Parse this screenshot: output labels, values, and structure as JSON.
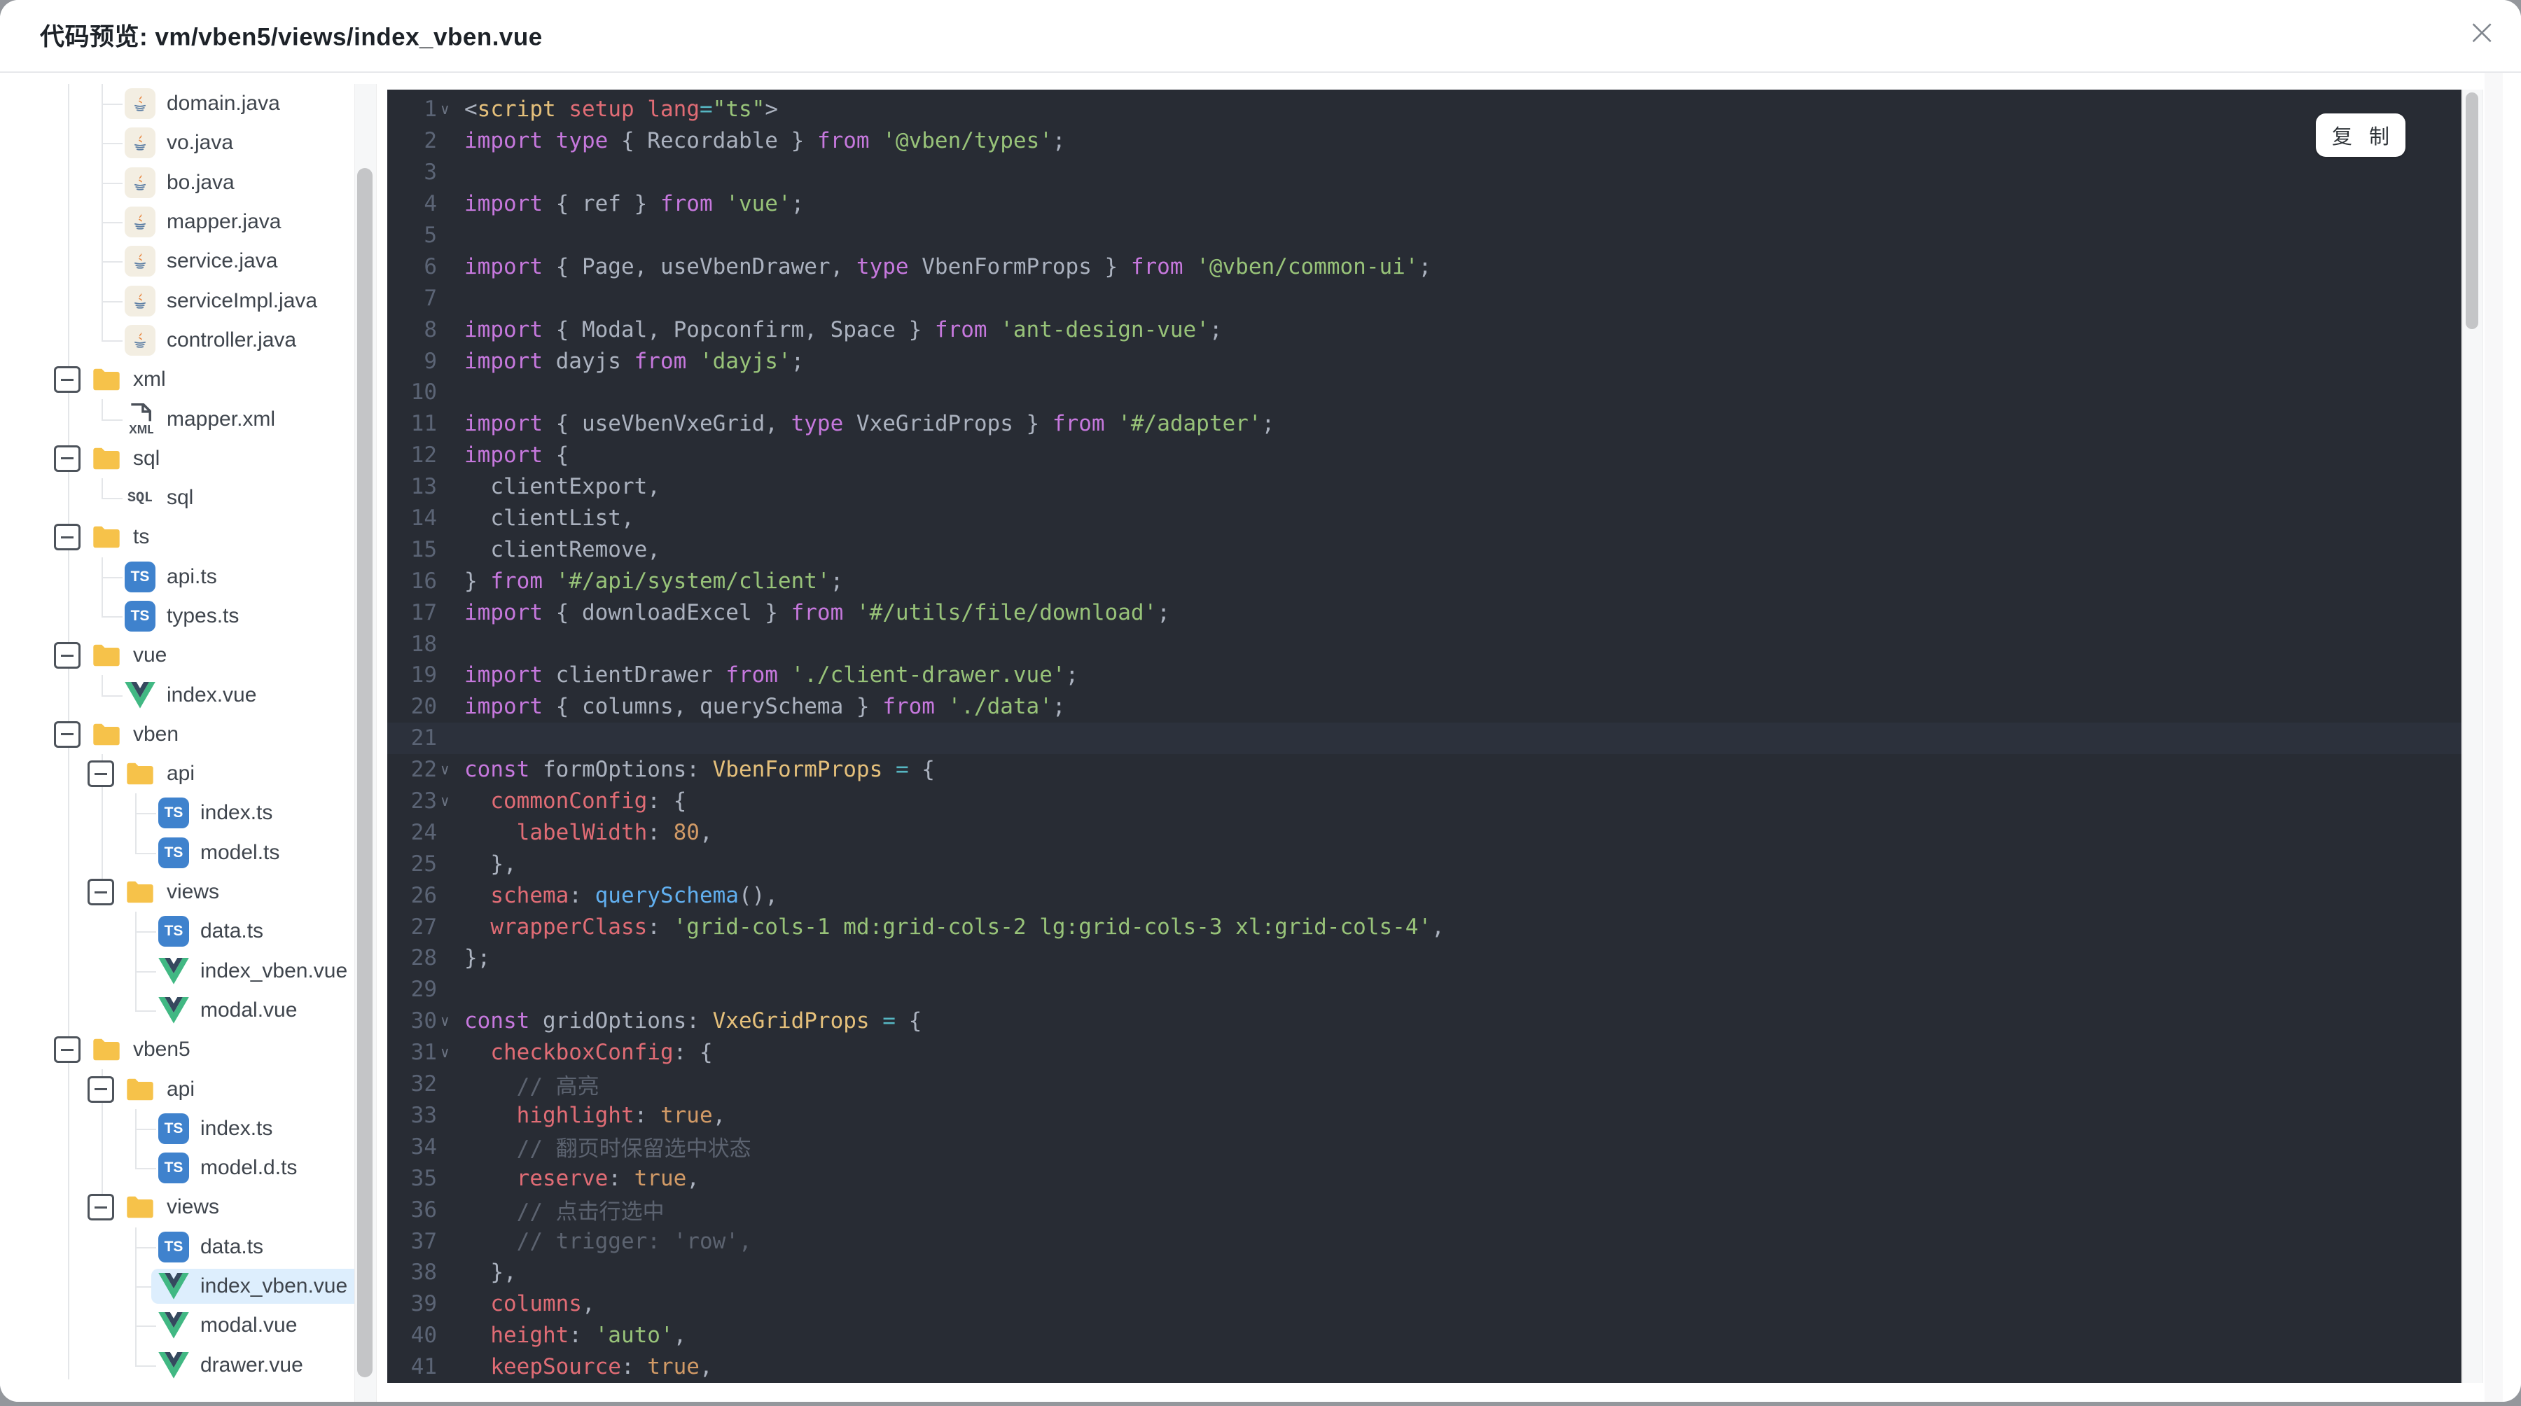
{
  "window": {
    "title": "代码预览: vm/vben5/views/index_vben.vue",
    "close_label": "×"
  },
  "toolbar": {
    "copy_label": "复 制"
  },
  "colors": {
    "editor_bg": "#282c34",
    "current_line": "#2c313c",
    "selected_item_bg": "#ddeefd",
    "folder": "#f6c24a",
    "ts_badge": "#3f82cd",
    "vue_green": "#41b883",
    "vue_navy": "#35495e",
    "keyword": "#c678dd",
    "string": "#98c379",
    "property": "#e06c75",
    "number": "#d19a66"
  },
  "sidebar": {
    "items": [
      {
        "label": "domain.java",
        "icon": "java",
        "stub": 145
      },
      {
        "label": "vo.java",
        "icon": "java",
        "stub": 145
      },
      {
        "label": "bo.java",
        "icon": "java",
        "stub": 145
      },
      {
        "label": "mapper.java",
        "icon": "java",
        "stub": 145
      },
      {
        "label": "service.java",
        "icon": "java",
        "stub": 145
      },
      {
        "label": "serviceImpl.java",
        "icon": "java",
        "stub": 145
      },
      {
        "label": "controller.java",
        "icon": "java",
        "stub": 145,
        "end": true
      },
      {
        "label": "xml",
        "icon": "folder",
        "exp": 77
      },
      {
        "label": "mapper.xml",
        "icon": "xml",
        "stub": 145,
        "end": true
      },
      {
        "label": "sql",
        "icon": "folder",
        "exp": 77
      },
      {
        "label": "sql",
        "icon": "sql",
        "stub": 145,
        "end": true
      },
      {
        "label": "ts",
        "icon": "folder",
        "exp": 77
      },
      {
        "label": "api.ts",
        "icon": "ts",
        "stub": 145
      },
      {
        "label": "types.ts",
        "icon": "ts",
        "stub": 145,
        "end": true
      },
      {
        "label": "vue",
        "icon": "folder",
        "exp": 77
      },
      {
        "label": "index.vue",
        "icon": "vue",
        "stub": 145,
        "end": true
      },
      {
        "label": "vben",
        "icon": "folder",
        "exp": 77
      },
      {
        "label": "api",
        "icon": "folder",
        "exp": 125,
        "guides": [
          145
        ]
      },
      {
        "label": "index.ts",
        "icon": "ts",
        "stub": 193,
        "guides": [
          145
        ]
      },
      {
        "label": "model.ts",
        "icon": "ts",
        "stub": 193,
        "guides": [
          145
        ],
        "end": true
      },
      {
        "label": "views",
        "icon": "folder",
        "exp": 125,
        "guides": [
          145
        ],
        "gend": true
      },
      {
        "label": "data.ts",
        "icon": "ts",
        "stub": 193
      },
      {
        "label": "index_vben.vue",
        "icon": "vue",
        "stub": 193
      },
      {
        "label": "modal.vue",
        "icon": "vue",
        "stub": 193,
        "end": true
      },
      {
        "label": "vben5",
        "icon": "folder",
        "exp": 77
      },
      {
        "label": "api",
        "icon": "folder",
        "exp": 125,
        "guides": [
          145
        ]
      },
      {
        "label": "index.ts",
        "icon": "ts",
        "stub": 193,
        "guides": [
          145
        ]
      },
      {
        "label": "model.d.ts",
        "icon": "ts",
        "stub": 193,
        "guides": [
          145
        ],
        "end": true
      },
      {
        "label": "views",
        "icon": "folder",
        "exp": 125,
        "guides": [
          145
        ],
        "gend": true
      },
      {
        "label": "data.ts",
        "icon": "ts",
        "stub": 193
      },
      {
        "label": "index_vben.vue",
        "icon": "vue",
        "stub": 193,
        "selected": true
      },
      {
        "label": "modal.vue",
        "icon": "vue",
        "stub": 193
      },
      {
        "label": "drawer.vue",
        "icon": "vue",
        "stub": 193,
        "end": true
      }
    ]
  },
  "code": {
    "lines": [
      {
        "n": 1,
        "f": 1,
        "t": [
          [
            "txt",
            "<"
          ],
          [
            "tag",
            "script"
          ],
          [
            "txt",
            " "
          ],
          [
            "prop",
            "setup"
          ],
          [
            "txt",
            " "
          ],
          [
            "prop",
            "lang"
          ],
          [
            "op",
            "="
          ],
          [
            "str",
            "\"ts\""
          ],
          [
            "txt",
            ">"
          ]
        ]
      },
      {
        "n": 2,
        "t": [
          [
            "kw",
            "import"
          ],
          [
            "txt",
            " "
          ],
          [
            "kw",
            "type"
          ],
          [
            "txt",
            " { Recordable } "
          ],
          [
            "kw",
            "from"
          ],
          [
            "txt",
            " "
          ],
          [
            "str",
            "'@vben/types'"
          ],
          [
            "txt",
            ";"
          ]
        ]
      },
      {
        "n": 3,
        "t": []
      },
      {
        "n": 4,
        "t": [
          [
            "kw",
            "import"
          ],
          [
            "txt",
            " { ref } "
          ],
          [
            "kw",
            "from"
          ],
          [
            "txt",
            " "
          ],
          [
            "str",
            "'vue'"
          ],
          [
            "txt",
            ";"
          ]
        ]
      },
      {
        "n": 5,
        "t": []
      },
      {
        "n": 6,
        "t": [
          [
            "kw",
            "import"
          ],
          [
            "txt",
            " { Page, useVbenDrawer, "
          ],
          [
            "kw",
            "type"
          ],
          [
            "txt",
            " VbenFormProps } "
          ],
          [
            "kw",
            "from"
          ],
          [
            "txt",
            " "
          ],
          [
            "str",
            "'@vben/common-ui'"
          ],
          [
            "txt",
            ";"
          ]
        ]
      },
      {
        "n": 7,
        "t": []
      },
      {
        "n": 8,
        "t": [
          [
            "kw",
            "import"
          ],
          [
            "txt",
            " { Modal, Popconfirm, Space } "
          ],
          [
            "kw",
            "from"
          ],
          [
            "txt",
            " "
          ],
          [
            "str",
            "'ant-design-vue'"
          ],
          [
            "txt",
            ";"
          ]
        ]
      },
      {
        "n": 9,
        "t": [
          [
            "kw",
            "import"
          ],
          [
            "txt",
            " dayjs "
          ],
          [
            "kw",
            "from"
          ],
          [
            "txt",
            " "
          ],
          [
            "str",
            "'dayjs'"
          ],
          [
            "txt",
            ";"
          ]
        ]
      },
      {
        "n": 10,
        "t": []
      },
      {
        "n": 11,
        "t": [
          [
            "kw",
            "import"
          ],
          [
            "txt",
            " { useVbenVxeGrid, "
          ],
          [
            "kw",
            "type"
          ],
          [
            "txt",
            " VxeGridProps } "
          ],
          [
            "kw",
            "from"
          ],
          [
            "txt",
            " "
          ],
          [
            "str",
            "'#/adapter'"
          ],
          [
            "txt",
            ";"
          ]
        ]
      },
      {
        "n": 12,
        "t": [
          [
            "kw",
            "import"
          ],
          [
            "txt",
            " {"
          ]
        ]
      },
      {
        "n": 13,
        "t": [
          [
            "txt",
            "  clientExport,"
          ]
        ]
      },
      {
        "n": 14,
        "t": [
          [
            "txt",
            "  clientList,"
          ]
        ]
      },
      {
        "n": 15,
        "t": [
          [
            "txt",
            "  clientRemove,"
          ]
        ]
      },
      {
        "n": 16,
        "t": [
          [
            "txt",
            "} "
          ],
          [
            "kw",
            "from"
          ],
          [
            "txt",
            " "
          ],
          [
            "str",
            "'#/api/system/client'"
          ],
          [
            "txt",
            ";"
          ]
        ]
      },
      {
        "n": 17,
        "t": [
          [
            "kw",
            "import"
          ],
          [
            "txt",
            " { downloadExcel } "
          ],
          [
            "kw",
            "from"
          ],
          [
            "txt",
            " "
          ],
          [
            "str",
            "'#/utils/file/download'"
          ],
          [
            "txt",
            ";"
          ]
        ]
      },
      {
        "n": 18,
        "t": []
      },
      {
        "n": 19,
        "t": [
          [
            "kw",
            "import"
          ],
          [
            "txt",
            " clientDrawer "
          ],
          [
            "kw",
            "from"
          ],
          [
            "txt",
            " "
          ],
          [
            "str",
            "'./client-drawer.vue'"
          ],
          [
            "txt",
            ";"
          ]
        ]
      },
      {
        "n": 20,
        "t": [
          [
            "kw",
            "import"
          ],
          [
            "txt",
            " { columns, querySchema } "
          ],
          [
            "kw",
            "from"
          ],
          [
            "txt",
            " "
          ],
          [
            "str",
            "'./data'"
          ],
          [
            "txt",
            ";"
          ]
        ]
      },
      {
        "n": 21,
        "hl": true,
        "t": []
      },
      {
        "n": 22,
        "f": 1,
        "t": [
          [
            "kw",
            "const"
          ],
          [
            "txt",
            " formOptions: "
          ],
          [
            "type",
            "VbenFormProps"
          ],
          [
            "txt",
            " "
          ],
          [
            "op",
            "="
          ],
          [
            "txt",
            " {"
          ]
        ]
      },
      {
        "n": 23,
        "f": 1,
        "t": [
          [
            "txt",
            "  "
          ],
          [
            "prop",
            "commonConfig"
          ],
          [
            "txt",
            ": {"
          ]
        ]
      },
      {
        "n": 24,
        "t": [
          [
            "txt",
            "    "
          ],
          [
            "prop",
            "labelWidth"
          ],
          [
            "txt",
            ": "
          ],
          [
            "num",
            "80"
          ],
          [
            "txt",
            ","
          ]
        ]
      },
      {
        "n": 25,
        "t": [
          [
            "txt",
            "  },"
          ]
        ]
      },
      {
        "n": 26,
        "t": [
          [
            "txt",
            "  "
          ],
          [
            "prop",
            "schema"
          ],
          [
            "txt",
            ": "
          ],
          [
            "fn",
            "querySchema"
          ],
          [
            "txt",
            "(),"
          ]
        ]
      },
      {
        "n": 27,
        "t": [
          [
            "txt",
            "  "
          ],
          [
            "prop",
            "wrapperClass"
          ],
          [
            "txt",
            ": "
          ],
          [
            "str",
            "'grid-cols-1 md:grid-cols-2 lg:grid-cols-3 xl:grid-cols-4'"
          ],
          [
            "txt",
            ","
          ]
        ]
      },
      {
        "n": 28,
        "t": [
          [
            "txt",
            "};"
          ]
        ]
      },
      {
        "n": 29,
        "t": []
      },
      {
        "n": 30,
        "f": 1,
        "t": [
          [
            "kw",
            "const"
          ],
          [
            "txt",
            " gridOptions: "
          ],
          [
            "type",
            "VxeGridProps"
          ],
          [
            "txt",
            " "
          ],
          [
            "op",
            "="
          ],
          [
            "txt",
            " {"
          ]
        ]
      },
      {
        "n": 31,
        "f": 1,
        "t": [
          [
            "txt",
            "  "
          ],
          [
            "prop",
            "checkboxConfig"
          ],
          [
            "txt",
            ": {"
          ]
        ]
      },
      {
        "n": 32,
        "t": [
          [
            "cmt",
            "    // 高亮"
          ]
        ]
      },
      {
        "n": 33,
        "t": [
          [
            "txt",
            "    "
          ],
          [
            "prop",
            "highlight"
          ],
          [
            "txt",
            ": "
          ],
          [
            "num",
            "true"
          ],
          [
            "txt",
            ","
          ]
        ]
      },
      {
        "n": 34,
        "t": [
          [
            "cmt",
            "    // 翻页时保留选中状态"
          ]
        ]
      },
      {
        "n": 35,
        "t": [
          [
            "txt",
            "    "
          ],
          [
            "prop",
            "reserve"
          ],
          [
            "txt",
            ": "
          ],
          [
            "num",
            "true"
          ],
          [
            "txt",
            ","
          ]
        ]
      },
      {
        "n": 36,
        "t": [
          [
            "cmt",
            "    // 点击行选中"
          ]
        ]
      },
      {
        "n": 37,
        "t": [
          [
            "cmt",
            "    // trigger: 'row',"
          ]
        ]
      },
      {
        "n": 38,
        "t": [
          [
            "txt",
            "  },"
          ]
        ]
      },
      {
        "n": 39,
        "t": [
          [
            "txt",
            "  "
          ],
          [
            "prop",
            "columns"
          ],
          [
            "txt",
            ","
          ]
        ]
      },
      {
        "n": 40,
        "t": [
          [
            "txt",
            "  "
          ],
          [
            "prop",
            "height"
          ],
          [
            "txt",
            ": "
          ],
          [
            "str",
            "'auto'"
          ],
          [
            "txt",
            ","
          ]
        ]
      },
      {
        "n": 41,
        "t": [
          [
            "txt",
            "  "
          ],
          [
            "prop",
            "keepSource"
          ],
          [
            "txt",
            ": "
          ],
          [
            "num",
            "true"
          ],
          [
            "txt",
            ","
          ]
        ]
      }
    ]
  }
}
